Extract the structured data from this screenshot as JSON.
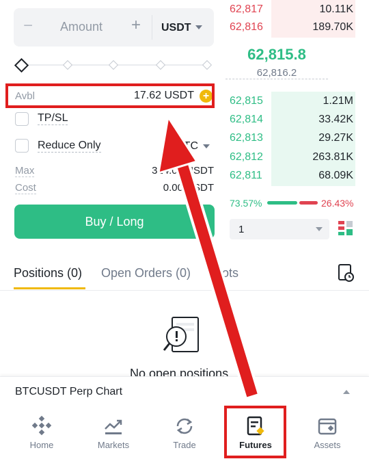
{
  "order_form": {
    "amount_minus": "−",
    "amount_placeholder": "Amount",
    "amount_plus": "+",
    "amount_unit": "USDT",
    "avbl_label": "Avbl",
    "avbl_value": "17.62 USDT",
    "avbl_plus": "+",
    "tpsl_label": "TP/SL",
    "reduce_only_label": "Reduce Only",
    "reduce_unit": "BTC",
    "max_label": "Max",
    "max_value": "314.08 USDT",
    "cost_label": "Cost",
    "cost_value": "0.00 USDT",
    "buy_label": "Buy / Long"
  },
  "order_book": {
    "asks": [
      {
        "price": "62,817",
        "qty": "10.11K",
        "depth": 0.65
      },
      {
        "price": "62,816",
        "qty": "189.70K",
        "depth": 0.65
      }
    ],
    "mid_price": "62,815.8",
    "mark_price": "62,816.2",
    "bids": [
      {
        "price": "62,815",
        "qty": "1.21M",
        "depth": 0.65
      },
      {
        "price": "62,814",
        "qty": "33.42K",
        "depth": 0.65
      },
      {
        "price": "62,813",
        "qty": "29.27K",
        "depth": 0.65
      },
      {
        "price": "62,812",
        "qty": "263.81K",
        "depth": 0.65
      },
      {
        "price": "62,811",
        "qty": "68.09K",
        "depth": 0.65
      }
    ],
    "buy_pct": "73.57%",
    "sell_pct": "26.43%",
    "depth_value": "1"
  },
  "tabs": {
    "positions": "Positions (0)",
    "open_orders": "Open Orders (0)",
    "bots": "Bots"
  },
  "empty_state": "No open positions",
  "chart_bar": {
    "title": "BTCUSDT Perp Chart"
  },
  "nav": {
    "home": "Home",
    "markets": "Markets",
    "trade": "Trade",
    "futures": "Futures",
    "assets": "Assets"
  },
  "colors": {
    "buy": "#2ebd85",
    "sell": "#e04351",
    "accent": "#f0b90b",
    "annotation": "#e01e1e"
  }
}
